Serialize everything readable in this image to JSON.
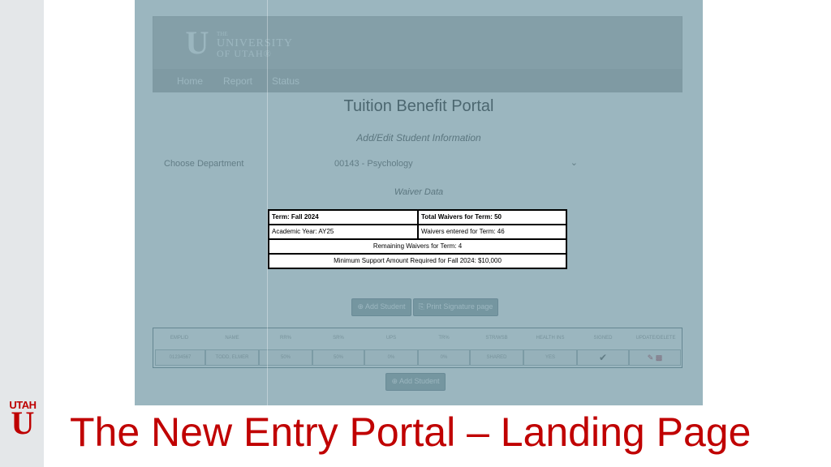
{
  "portal": {
    "logo": {
      "line1": "THE",
      "line2": "UNIVERSITY",
      "line3": "OF UTAH®",
      "mark": "U"
    },
    "nav": [
      "Home",
      "Report",
      "Status"
    ],
    "title": "Tuition Benefit Portal",
    "subtitle": "Add/Edit Student Information",
    "department": {
      "label": "Choose Department",
      "value": "00143 - Psychology",
      "chevron": "chevron-down-icon"
    },
    "waiver_section_title": "Waiver Data",
    "add_student_top": "Add Student",
    "print_signature": "Print Signature page",
    "add_student_bottom": "Add Student",
    "grid": {
      "headers": [
        "EMPLID",
        "NAME",
        "RR%",
        "SR%",
        "UPS",
        "TR%",
        "STR/WSB",
        "HEALTH INS",
        "SIGNED",
        "UPDATE/DELETE"
      ],
      "row": [
        "01234567",
        "TODD, ELMER",
        "50%",
        "50%",
        "0%",
        "0%",
        "SHARED",
        "YES",
        "",
        ""
      ]
    }
  },
  "waiver_table": {
    "term": "Term: Fall 2024",
    "total_waivers": "Total Waivers for Term: 50",
    "academic_year": "Academic Year: AY25",
    "waivers_entered": "Waivers entered for Term: 46",
    "remaining": "Remaining Waivers for Term: 4",
    "minimum_support": "Minimum Support Amount Required for Fall 2024: $10,000"
  },
  "slide": {
    "title": "The New Entry Portal – Landing Page",
    "logo_word": "UTAH",
    "logo_mark": "U"
  },
  "colors": {
    "overlay": "#528291",
    "title_red": "#c00000",
    "utah_red": "#be0000"
  }
}
